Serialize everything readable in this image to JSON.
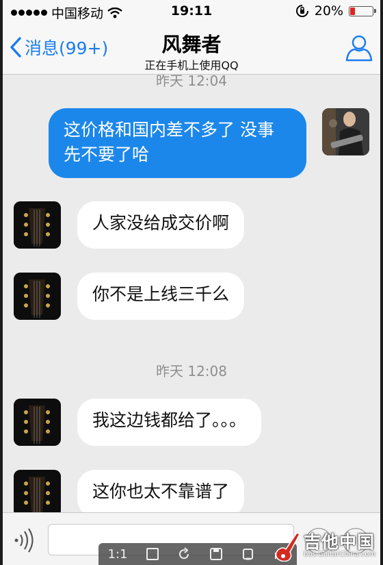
{
  "status_bar": {
    "carrier": "中国移动",
    "time": "19:11",
    "battery_percent": "20%",
    "battery_level": 0.2,
    "battery_color": "#e0261f"
  },
  "nav": {
    "back_label": "消息(99+)",
    "title": "风舞者",
    "subtitle": "正在手机上使用QQ",
    "back_icon": "chevron-left-icon",
    "profile_icon": "person-icon",
    "accent_color": "#1a7cf0"
  },
  "chat": {
    "messages": [
      {
        "type": "timestamp",
        "text": "昨天 12:04"
      },
      {
        "type": "outgoing",
        "text": "这价格和国内差不多了 没事 先不要了哈",
        "avatar": "guitarist-photo"
      },
      {
        "type": "incoming",
        "text": "人家没给成交价啊",
        "avatar": "guitar-headstock-photo"
      },
      {
        "type": "incoming",
        "text": "你不是上线三千么",
        "avatar": "guitar-headstock-photo"
      },
      {
        "type": "timestamp",
        "text": "昨天 12:08"
      },
      {
        "type": "incoming",
        "text": "我这边钱都给了。。。",
        "avatar": "guitar-headstock-photo"
      },
      {
        "type": "incoming",
        "text": "这你也太不靠谱了",
        "avatar": "guitar-headstock-photo"
      }
    ],
    "outgoing_color": "#1c87ea",
    "incoming_color": "#ffffff"
  },
  "input_bar": {
    "voice_icon": "voice-icon",
    "placeholder": ""
  },
  "viewer_toolbar": {
    "ratio_label": "1:1",
    "icons": [
      "fit-icon",
      "rotate-icon",
      "save-icon",
      "copy-icon",
      "share-icon"
    ]
  },
  "watermark": {
    "text": "吉他中国",
    "url": "bbs.GuitarChina.com"
  }
}
